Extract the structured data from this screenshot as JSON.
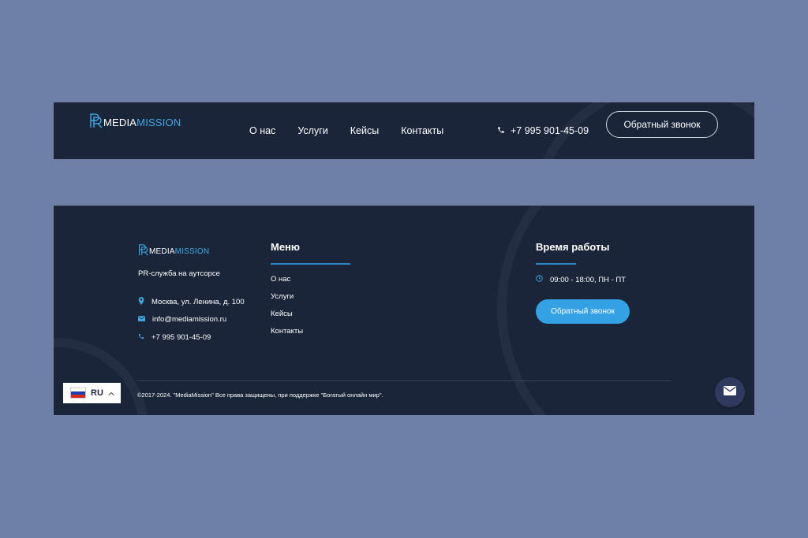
{
  "brand": {
    "logo_mark": "PR",
    "logo_word1": "MEDIA",
    "logo_word2": "MISSION",
    "accent": "#3fa9e6"
  },
  "header": {
    "nav": [
      {
        "label": "О нас"
      },
      {
        "label": "Услуги"
      },
      {
        "label": "Кейсы"
      },
      {
        "label": "Контакты"
      }
    ],
    "phone": "+7 995 901-45-09",
    "phone_icon": "phone-icon",
    "callback_label": "Обратный звонок"
  },
  "footer": {
    "tagline": "PR-служба на аутсорсе",
    "address": "Москва, ул. Ленина, д. 100",
    "email": "info@mediamission.ru",
    "phone": "+7 995 901-45-09",
    "icons": {
      "address": "location-pin-icon",
      "email": "envelope-icon",
      "phone": "phone-icon"
    },
    "menu_title": "Меню",
    "menu": [
      {
        "label": "О нас"
      },
      {
        "label": "Услуги"
      },
      {
        "label": "Кейсы"
      },
      {
        "label": "Контакты"
      }
    ],
    "hours_title": "Время работы",
    "hours": "09:00 - 18:00, ПН - ПТ",
    "hours_icon": "clock-icon",
    "callback_label": "Обратный звонок",
    "copyright": "©2017-2024. \"MediaMission\" Все права защищены, при поддержке \"Богатый онлайн мир\"."
  },
  "language": {
    "code": "RU",
    "flag": "russia-flag-icon",
    "chevron": "chevron-up-icon"
  },
  "chat": {
    "icon": "mail-icon"
  },
  "colors": {
    "page_bg": "#6f80a7",
    "panel_bg": "#1b253a",
    "button_blue": "#33a1e4"
  }
}
